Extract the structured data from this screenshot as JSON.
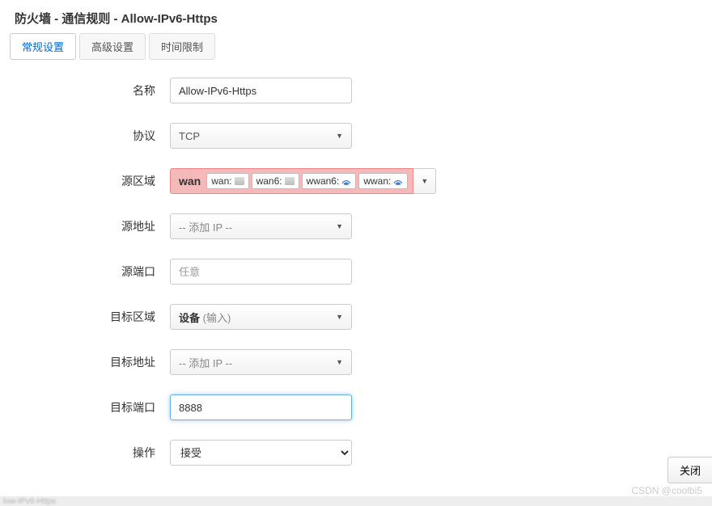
{
  "header": {
    "title": "防火墙 - 通信规则 - Allow-IPv6-Https"
  },
  "tabs": {
    "general": "常规设置",
    "advanced": "高级设置",
    "time": "时间限制"
  },
  "form": {
    "name_label": "名称",
    "name_value": "Allow-IPv6-Https",
    "protocol_label": "协议",
    "protocol_value": "TCP",
    "src_zone_label": "源区域",
    "src_zone_name": "wan",
    "src_zone_items": [
      {
        "label": "wan:",
        "icon": "eth"
      },
      {
        "label": "wan6:",
        "icon": "eth"
      },
      {
        "label": "wwan6:",
        "icon": "wifi"
      },
      {
        "label": "wwan:",
        "icon": "wifi"
      }
    ],
    "src_addr_label": "源地址",
    "src_addr_placeholder": "-- 添加 IP --",
    "src_port_label": "源端口",
    "src_port_placeholder": "任意",
    "dest_zone_label": "目标区域",
    "dest_zone_value": "设备",
    "dest_zone_suffix": "(输入)",
    "dest_addr_label": "目标地址",
    "dest_addr_placeholder": "-- 添加 IP --",
    "dest_port_label": "目标端口",
    "dest_port_value": "8888",
    "action_label": "操作",
    "action_value": "接受"
  },
  "footer": {
    "close": "关闭"
  },
  "watermark": "CSDN @coolbi5"
}
